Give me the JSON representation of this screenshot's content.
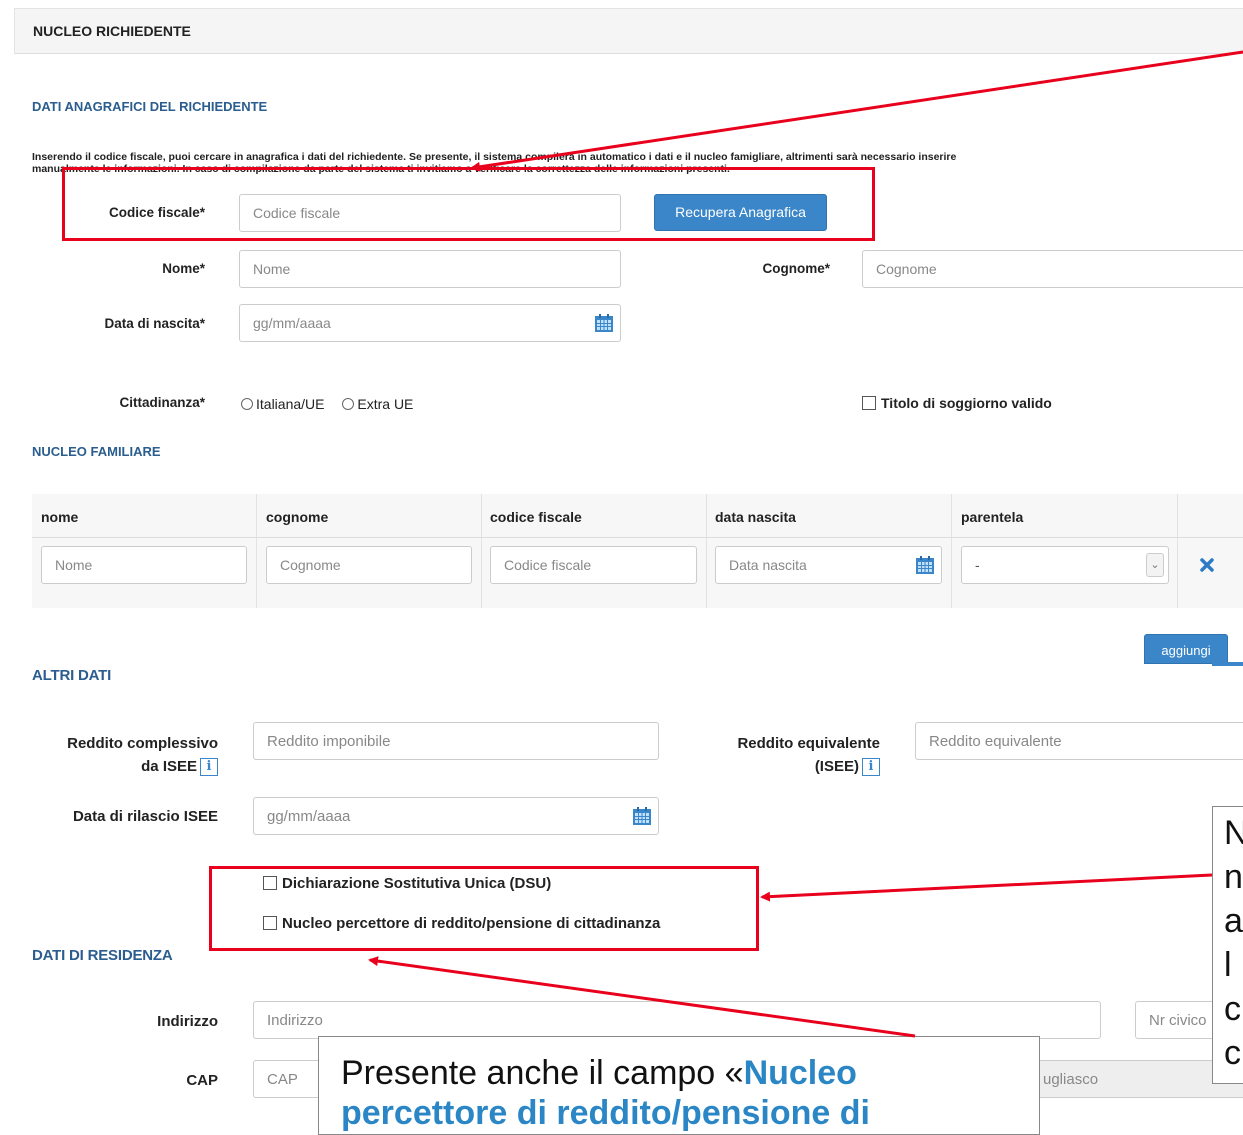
{
  "header": {
    "title": "NUCLEO RICHIEDENTE"
  },
  "applicant": {
    "section_title": "DATI ANAGRAFICI DEL RICHIEDENTE",
    "info_line1": "Inserendo il codice fiscale, puoi cercare in anagrafica i dati del richiedente. Se presente, il sistema compilerà in automatico i dati e il nucleo famigliare, altrimenti sarà necessario inserire",
    "info_line2": "manualmente le informazioni. In caso di compilazione da parte del sistema ti invitiamo a verificare la correttezza delle informazioni presenti.",
    "cf_label": "Codice fiscale*",
    "cf_placeholder": "Codice fiscale",
    "lookup_button": "Recupera Anagrafica",
    "nome_label": "Nome*",
    "nome_placeholder": "Nome",
    "cognome_label": "Cognome*",
    "cognome_placeholder": "Cognome",
    "dob_label": "Data di nascita*",
    "dob_placeholder": "gg/mm/aaaa",
    "citizenship_label": "Cittadinanza*",
    "citizenship_opt1": "Italiana/UE",
    "citizenship_opt2": "Extra UE",
    "permit_label": "Titolo di soggiorno valido"
  },
  "family": {
    "section_title": "NUCLEO FAMILIARE",
    "columns": [
      "nome",
      "cognome",
      "codice fiscale",
      "data nascita",
      "parentela"
    ],
    "row_placeholders": [
      "Nome",
      "Cognome",
      "Codice fiscale",
      "Data nascita"
    ],
    "relation_value": "-",
    "add_button": "aggiungi"
  },
  "other": {
    "section_title": "ALTRI DATI",
    "income_label_l1": "Reddito complessivo",
    "income_label_l2": "da ISEE",
    "income_placeholder": "Reddito imponibile",
    "equiv_label_l1": "Reddito equivalente",
    "equiv_label_l2": "(ISEE)",
    "equiv_placeholder": "Reddito equivalente",
    "isee_date_label": "Data di rilascio ISEE",
    "isee_date_placeholder": "gg/mm/aaaa",
    "info_glyph": "i",
    "dsu_label": "Dichiarazione Sostitutiva Unica (DSU)",
    "rdc_label": "Nucleo percettore di reddito/pensione di cittadinanza"
  },
  "residence": {
    "section_title": "DATI DI RESIDENZA",
    "address_label": "Indirizzo",
    "address_placeholder": "Indirizzo",
    "civic_placeholder": "Nr civico",
    "cap_label": "CAP",
    "cap_placeholder": "CAP",
    "city_value": "ugliasco"
  },
  "callouts": {
    "bottom_prefix": "Presente anche il campo «",
    "bottom_bold_l1": "Nucleo",
    "bottom_bold_l2": "percettore di reddito/pensione di",
    "right_lines": [
      "N",
      "n",
      "a",
      "l",
      "c",
      "c"
    ]
  },
  "colors": {
    "accent": "#2b5d8f",
    "button": "#3a86c8",
    "annotation": "#e8001c",
    "callout_bold": "#2b86c5"
  },
  "icons": [
    "calendar-icon",
    "close-icon",
    "info-icon",
    "chevron-down-icon"
  ]
}
